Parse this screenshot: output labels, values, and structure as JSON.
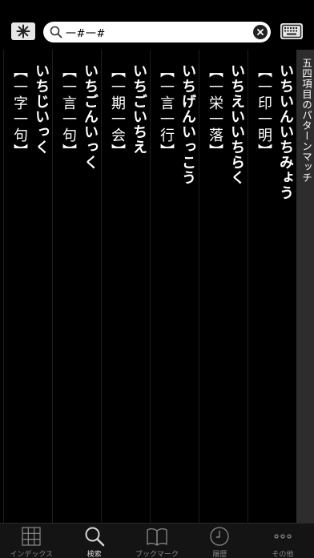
{
  "search": {
    "query": "一#一#",
    "placeholder": ""
  },
  "side_tab": {
    "label": "五四項目のパターンマッチ"
  },
  "results": [
    {
      "reading": "いちいんいちみょう",
      "kanji": "【一印一明】"
    },
    {
      "reading": "いちえいいちらく",
      "kanji": "【一栄一落】"
    },
    {
      "reading": "いちげんいっこう",
      "kanji": "【一言一行】"
    },
    {
      "reading": "いちごいちえ",
      "kanji": "【一期一会】"
    },
    {
      "reading": "いちごんいっく",
      "kanji": "【一言一句】"
    },
    {
      "reading": "いちじいっく",
      "kanji": "【一字一句】"
    }
  ],
  "tabbar": {
    "items": [
      {
        "label": "インデックス",
        "icon": "grid-icon"
      },
      {
        "label": "検索",
        "icon": "search-icon"
      },
      {
        "label": "ブックマーク",
        "icon": "book-icon"
      },
      {
        "label": "履歴",
        "icon": "clock-icon"
      },
      {
        "label": "その他",
        "icon": "more-icon"
      }
    ],
    "active_index": 1
  },
  "colors": {
    "background": "#000000",
    "side_tab": "#2d2d2d",
    "tabbar": "#141414",
    "inactive_label": "#8a8a8a"
  }
}
